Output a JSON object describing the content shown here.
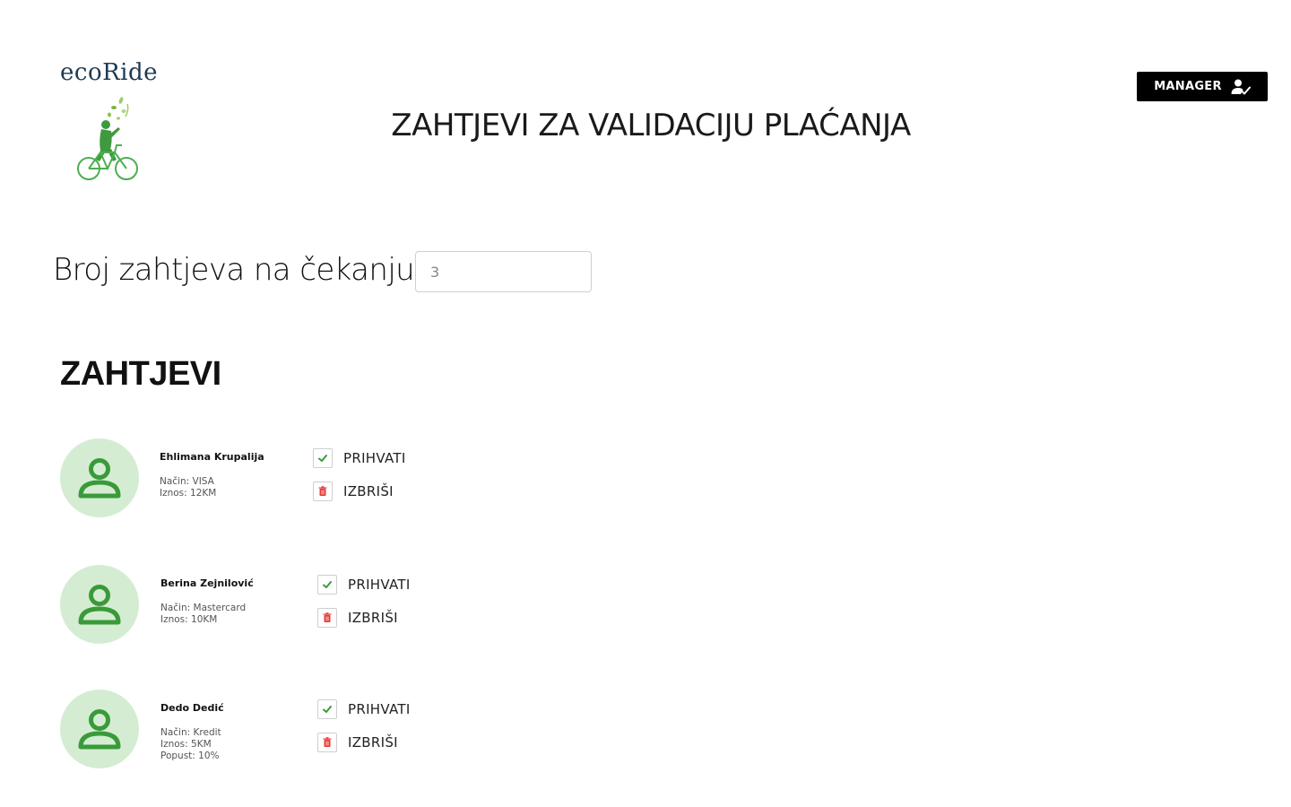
{
  "brand": {
    "name": "ecoRide"
  },
  "header": {
    "title": "ZAHTJEVI ZA VALIDACIJU PLAĆANJA"
  },
  "user_menu": {
    "label": "MANAGER",
    "icon": "user-check-icon"
  },
  "pending": {
    "label": "Broj zahtjeva na čekanju:",
    "value": "3"
  },
  "section": {
    "title": "ZAHTJEVI"
  },
  "colors": {
    "accent_green": "#3a9a3a",
    "avatar_bg": "#d4edd2",
    "delete_red": "#e53935"
  },
  "requests": [
    {
      "name": "Ehlimana Krupalija",
      "details": [
        "Način: VISA",
        "Iznos: 12KM"
      ],
      "accept_label": "PRIHVATI",
      "delete_label": "IZBRIŠI"
    },
    {
      "name": "Berina Zejnilović",
      "details": [
        "Način: Mastercard",
        "Iznos: 10KM"
      ],
      "accept_label": "PRIHVATI",
      "delete_label": "IZBRIŠI"
    },
    {
      "name": "Dedo Dedić",
      "details": [
        "Način: Kredit",
        "Iznos: 5KM",
        "Popust: 10%"
      ],
      "accept_label": "PRIHVATI",
      "delete_label": "IZBRIŠI"
    }
  ]
}
